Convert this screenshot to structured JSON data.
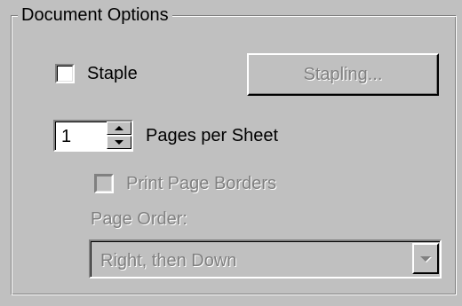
{
  "group": {
    "title": "Document Options"
  },
  "staple": {
    "label": "Staple",
    "checked": false,
    "enabled": true
  },
  "stapling_button": {
    "label": "Stapling...",
    "enabled": false
  },
  "pages_per_sheet": {
    "value": "1",
    "label": "Pages per Sheet"
  },
  "print_page_borders": {
    "label": "Print Page Borders",
    "checked": false,
    "enabled": false
  },
  "page_order": {
    "label": "Page Order:",
    "selected": "Right, then Down",
    "enabled": false
  },
  "icons": {
    "spin_up": "arrow-up-icon",
    "spin_down": "arrow-down-icon",
    "combo_dropdown": "chevron-down-icon"
  },
  "colors": {
    "face": "#c0c0c0",
    "disabled_text": "#808080",
    "highlight": "#ffffff",
    "shadow": "#808080"
  }
}
